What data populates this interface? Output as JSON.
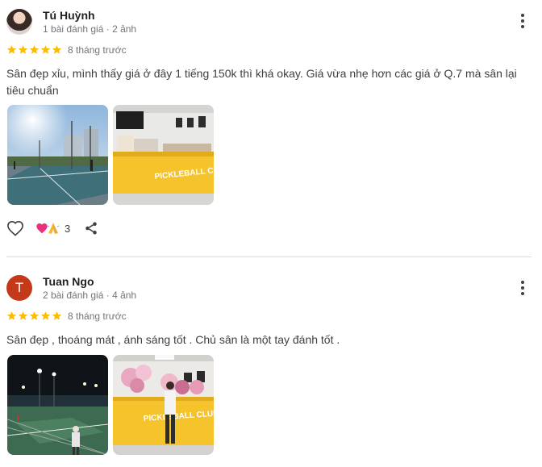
{
  "colors": {
    "star": "#fbbc04",
    "avatar_t": "#c5391b",
    "meta": "#70757a"
  },
  "reviews": [
    {
      "author": "Tú Huỳnh",
      "avatar": "photo",
      "meta": "1 bài đánh giá · 2 ảnh",
      "rating": 5,
      "time": "8 tháng trước",
      "text": "Sân đẹp xỉu, mình thấy giá ở đây 1 tiếng 150k thì khá okay. Giá vừa nhẹ hơn các giá ở Q.7 mà sân lại tiêu chuẩn",
      "photos": [
        "outdoor-courts-daylight",
        "pickleball-club-counter"
      ],
      "reaction_count": "3",
      "icons": {
        "like": "heart-outline-icon",
        "reactions": "heart-and-pray-emoji",
        "share": "share-icon"
      }
    },
    {
      "author": "Tuan Ngo",
      "avatar": "T",
      "meta": "2 bài đánh giá · 4 ảnh",
      "rating": 5,
      "time": "8 tháng trước",
      "text": "Sân đẹp , thoáng mát , ánh sáng tốt . Chủ sân là một tay đánh tốt .",
      "photos": [
        "night-courts-lights",
        "club-counter-flowers"
      ]
    }
  ]
}
